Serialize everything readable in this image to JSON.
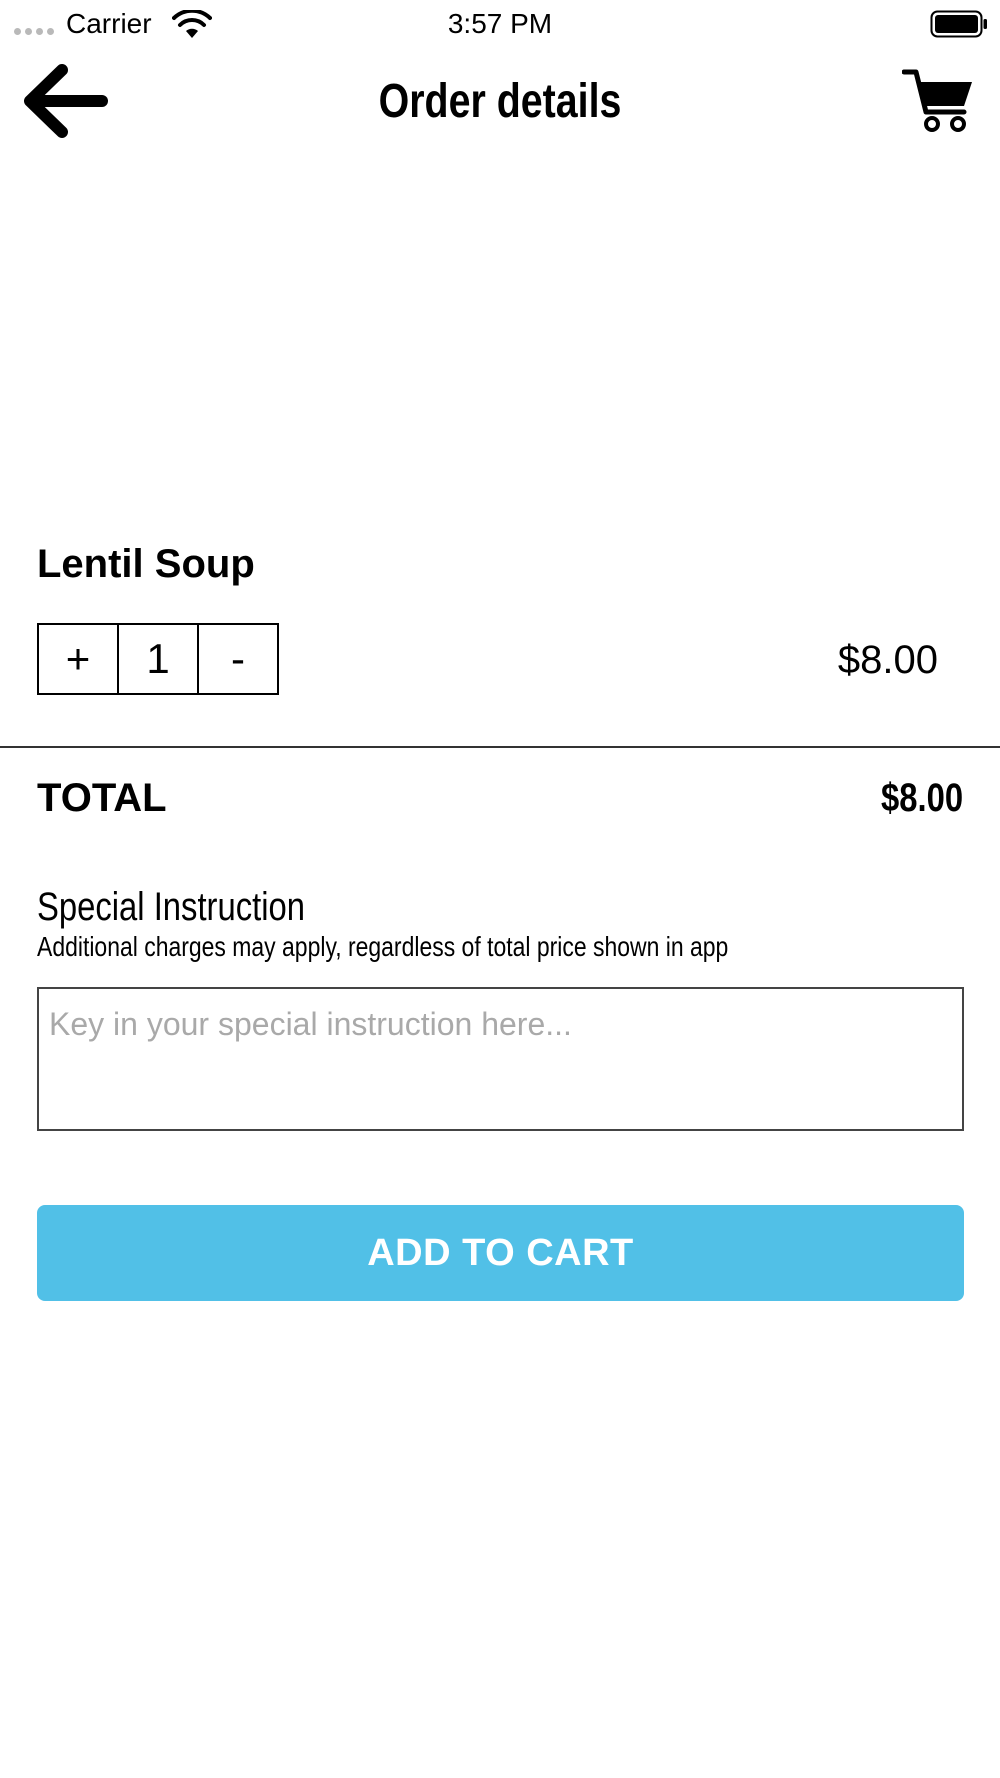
{
  "status_bar": {
    "carrier": "Carrier",
    "time": "3:57 PM"
  },
  "header": {
    "title": "Order details",
    "back_icon": "arrow-left-icon",
    "cart_icon": "shopping-cart-icon"
  },
  "item": {
    "name": "Lentil Soup",
    "quantity": "1",
    "increment_label": "+",
    "decrement_label": "-",
    "price": "$8.00"
  },
  "total": {
    "label": "TOTAL",
    "value": "$8.00"
  },
  "special_instruction": {
    "title": "Special Instruction",
    "note": "Additional charges may apply, regardless of total price shown in app",
    "value": "",
    "placeholder": "Key in your special instruction here..."
  },
  "actions": {
    "add_to_cart_label": "ADD TO CART"
  },
  "colors": {
    "accent": "#51c0e7",
    "divider": "#333333",
    "placeholder": "#a9a9a9"
  }
}
